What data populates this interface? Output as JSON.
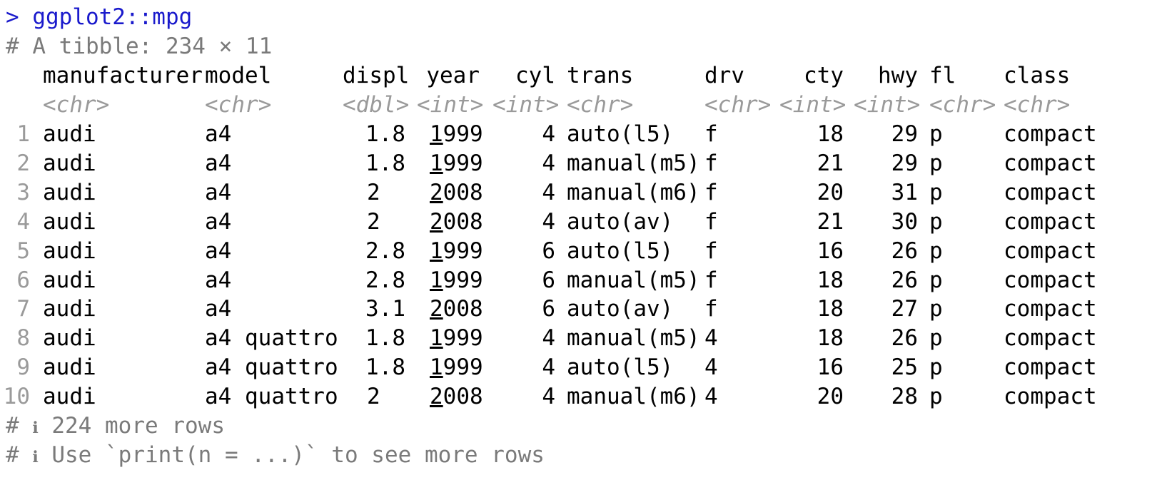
{
  "console": {
    "command": "> ggplot2::mpg",
    "tibble_header": "# A tibble: 234 × 11",
    "footer_more_rows": "224 more rows",
    "footer_print_hint": "Use `print(n = ...)` to see more rows",
    "footer_prefix": "# ",
    "info_icon": "info-icon",
    "colors": {
      "prompt": "#1a1acc",
      "comment": "#7a7a7a",
      "type": "#9a9a9a"
    }
  },
  "table": {
    "columns": [
      "manufacturer",
      "model",
      "displ",
      "year",
      "cyl",
      "trans",
      "drv",
      "cty",
      "hwy",
      "fl",
      "class"
    ],
    "types": [
      "<chr>",
      "<chr>",
      "<dbl>",
      "<int>",
      "<int>",
      "<chr>",
      "<chr>",
      "<int>",
      "<int>",
      "<chr>",
      "<chr>"
    ],
    "rows": [
      [
        "1",
        "audi",
        "a4",
        "1.8",
        "1999",
        "4",
        "auto(l5)",
        "f",
        "18",
        "29",
        "p",
        "compact"
      ],
      [
        "2",
        "audi",
        "a4",
        "1.8",
        "1999",
        "4",
        "manual(m5)",
        "f",
        "21",
        "29",
        "p",
        "compact"
      ],
      [
        "3",
        "audi",
        "a4",
        "2",
        "2008",
        "4",
        "manual(m6)",
        "f",
        "20",
        "31",
        "p",
        "compact"
      ],
      [
        "4",
        "audi",
        "a4",
        "2",
        "2008",
        "4",
        "auto(av)",
        "f",
        "21",
        "30",
        "p",
        "compact"
      ],
      [
        "5",
        "audi",
        "a4",
        "2.8",
        "1999",
        "6",
        "auto(l5)",
        "f",
        "16",
        "26",
        "p",
        "compact"
      ],
      [
        "6",
        "audi",
        "a4",
        "2.8",
        "1999",
        "6",
        "manual(m5)",
        "f",
        "18",
        "26",
        "p",
        "compact"
      ],
      [
        "7",
        "audi",
        "a4",
        "3.1",
        "2008",
        "6",
        "auto(av)",
        "f",
        "18",
        "27",
        "p",
        "compact"
      ],
      [
        "8",
        "audi",
        "a4 quattro",
        "1.8",
        "1999",
        "4",
        "manual(m5)",
        "4",
        "18",
        "26",
        "p",
        "compact"
      ],
      [
        "9",
        "audi",
        "a4 quattro",
        "1.8",
        "1999",
        "4",
        "auto(l5)",
        "4",
        "16",
        "25",
        "p",
        "compact"
      ],
      [
        "10",
        "audi",
        "a4 quattro",
        "2",
        "2008",
        "4",
        "manual(m6)",
        "4",
        "20",
        "28",
        "p",
        "compact"
      ]
    ]
  }
}
